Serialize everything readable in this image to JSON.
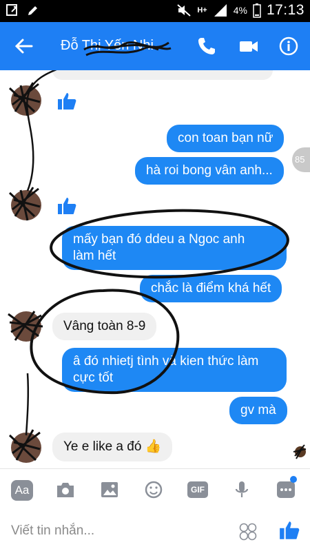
{
  "status_bar": {
    "time": "17:13",
    "battery": "4%",
    "network": "H+"
  },
  "header": {
    "contact_name": "Đỗ Thị Yến Nhi"
  },
  "messages": [
    {
      "text": "con toan bạn nữ",
      "sender": "me"
    },
    {
      "text": "hà roi bong vân anh...",
      "sender": "me"
    },
    {
      "text": "mấy bạn đó ddeu a Ngoc anh",
      "text2": "làm hết",
      "sender": "me"
    },
    {
      "text": "chắc là điểm khá hết",
      "sender": "me"
    },
    {
      "text": "Vâng toàn 8-9",
      "sender": "them"
    },
    {
      "text": "â đó nhietj tình và kien thức làm",
      "text2": "cực tốt",
      "sender": "me"
    },
    {
      "text": "gv mà",
      "sender": "me"
    },
    {
      "text": "Ye e like a đó",
      "sender": "them"
    }
  ],
  "seen_count": "85",
  "toolbar": {
    "aa_label": "Aa",
    "gif_label": "GIF"
  },
  "composer": {
    "placeholder": "Viết tin nhắn..."
  },
  "colors": {
    "brand": "#1e7ff4",
    "outgoing_bubble": "#1e88f4",
    "incoming_bubble": "#f0f0f0"
  }
}
